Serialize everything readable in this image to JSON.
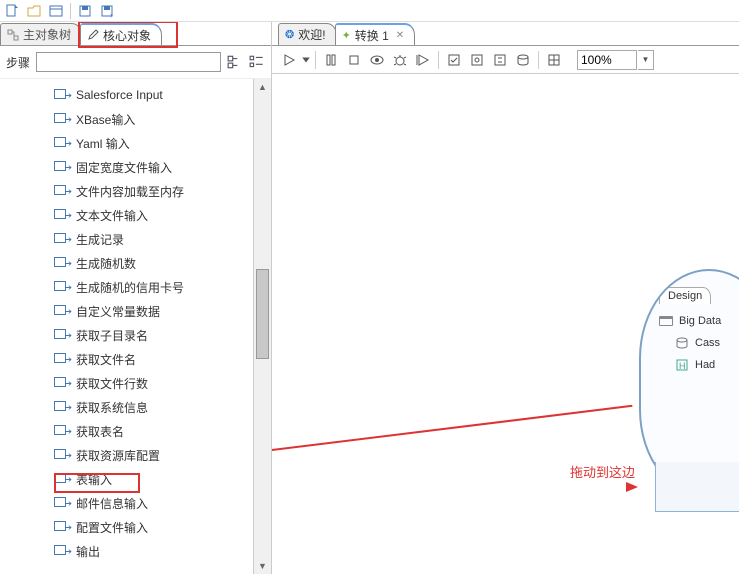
{
  "left": {
    "tab_main": "主对象树",
    "tab_core": "核心对象",
    "steps_label": "步骤",
    "search_placeholder": "",
    "items": [
      "Salesforce Input",
      "XBase输入",
      "Yaml 输入",
      "固定宽度文件输入",
      "文件内容加载至内存",
      "文本文件输入",
      "生成记录",
      "生成随机数",
      "生成随机的信用卡号",
      "自定义常量数据",
      "获取子目录名",
      "获取文件名",
      "获取文件行数",
      "获取系统信息",
      "获取表名",
      "获取资源库配置",
      "表输入",
      "邮件信息输入",
      "配置文件输入",
      "输出"
    ]
  },
  "right": {
    "tab_welcome": "欢迎!",
    "tab_trans": "转换 1",
    "zoom": "100%",
    "annotation": "拖动到这边"
  },
  "palette": {
    "tab": "Design",
    "items": [
      {
        "icon": "folder",
        "label": "Big Data"
      },
      {
        "icon": "db",
        "label": "Cass"
      },
      {
        "icon": "h",
        "label": "Had"
      }
    ]
  }
}
